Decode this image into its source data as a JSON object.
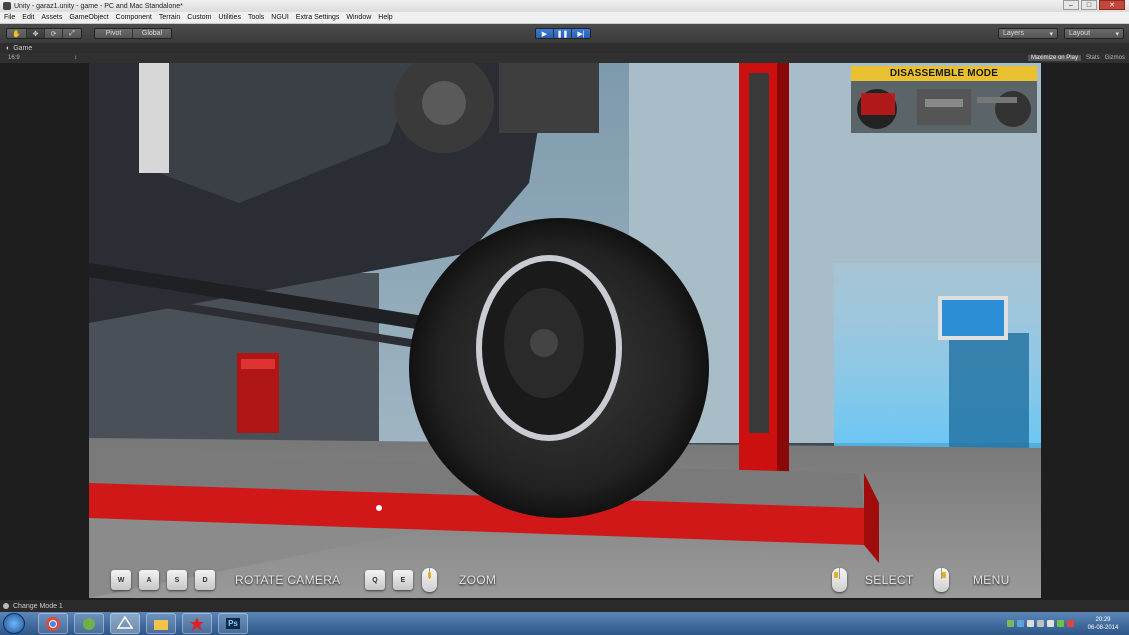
{
  "window": {
    "title": "Unity - garaz1.unity - game - PC and Mac Standalone*",
    "min_label": "–",
    "max_label": "□",
    "close_label": "✕"
  },
  "menu": {
    "items": [
      "File",
      "Edit",
      "Assets",
      "GameObject",
      "Component",
      "Terrain",
      "Custom",
      "Utilities",
      "Tools",
      "NGUI",
      "Extra Settings",
      "Window",
      "Help"
    ]
  },
  "toolbar": {
    "pivot_label": "Pivot",
    "global_label": "Global",
    "layers_label": "Layers",
    "layout_label": "Layout"
  },
  "game_view": {
    "tab_label": "Game",
    "aspect_label": "16:9",
    "maximize_label": "Maximize on Play",
    "stats_label": "Stats",
    "gizmos_label": "Gizmos"
  },
  "game_hud": {
    "mode_title": "DISASSEMBLE MODE",
    "keys": [
      "W",
      "A",
      "S",
      "D"
    ],
    "rotate_label": "ROTATE CAMERA",
    "zoom_keys": [
      "Q",
      "E"
    ],
    "zoom_label": "ZOOM",
    "select_label": "SELECT",
    "menu_label": "MENU"
  },
  "status": {
    "message": "Change Mode 1"
  },
  "taskbar": {
    "ps_label": "Ps",
    "time": "20:29",
    "date": "06-08-2014"
  },
  "colors": {
    "accent_yellow": "#e8c030",
    "lift_red": "#cc1010",
    "play_blue": "#3b7bd8"
  }
}
